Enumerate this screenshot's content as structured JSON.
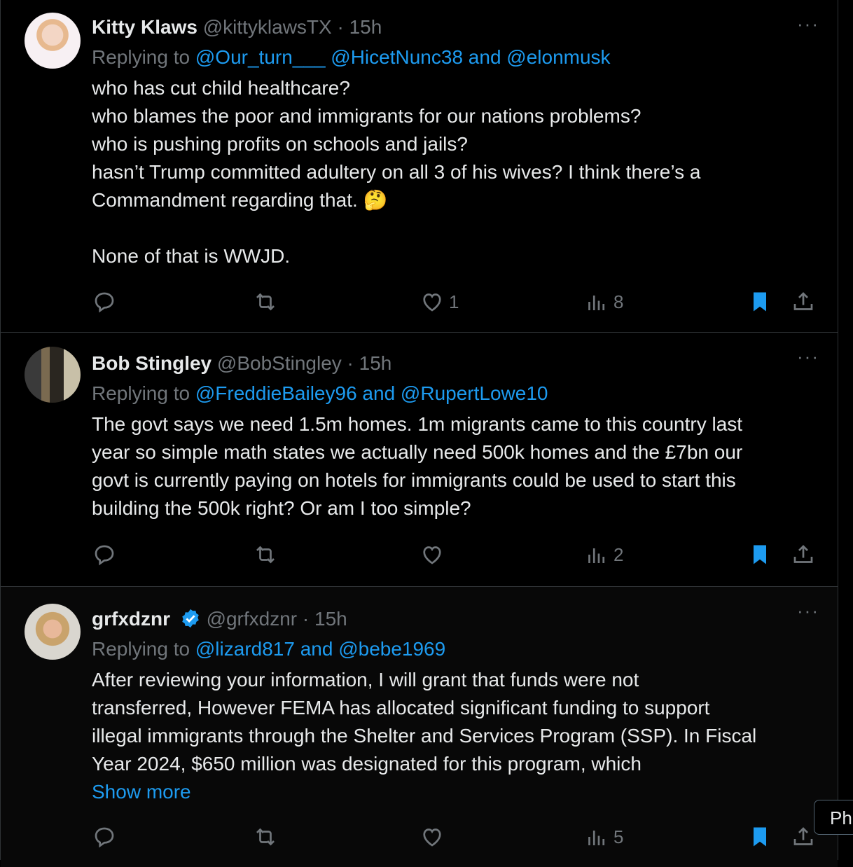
{
  "tweets": [
    {
      "name": "Kitty Klaws",
      "handle": "@kittyklawsTX",
      "time": "· 15h",
      "replying_prefix": "Replying to",
      "replying_to": "@Our_turn___ @HicetNunc38 and @elonmusk",
      "lines": [
        "who has cut child healthcare?",
        "who blames the poor and immigrants for our nations problems?",
        "who is pushing profits on schools and jails?",
        "hasn’t Trump committed adultery on all 3 of his wives? I think there’s a",
        "Commandment regarding that. 🤔",
        "",
        "None of that is WWJD."
      ],
      "likes": "1",
      "views": "8",
      "more": "···"
    },
    {
      "name": "Bob Stingley",
      "handle": "@BobStingley",
      "time": "· 15h",
      "replying_prefix": "Replying to",
      "replying_to": "@FreddieBailey96 and @RupertLowe10",
      "lines": [
        "The govt says we need 1.5m homes. 1m migrants came to this country last",
        "year so simple math states we actually need 500k homes and the £7bn our",
        "govt is currently paying on hotels for immigrants could be used to start this",
        "building the 500k right? Or am I too simple?"
      ],
      "likes": "",
      "views": "2",
      "more": "···"
    },
    {
      "name": "grfxdznr",
      "handle": "@grfxdznr",
      "time": "· 15h",
      "replying_prefix": "Replying to",
      "replying_to": "@lizard817 and @bebe1969",
      "lines": [
        "After reviewing your information, I will grant that funds were not",
        "transferred, However FEMA has allocated significant funding to support",
        "illegal immigrants through the Shelter and Services Program (SSP). In Fiscal",
        "Year 2024, $650 million was designated for this program, which"
      ],
      "show_more": "Show more",
      "likes": "",
      "views": "5",
      "more": "···"
    }
  ],
  "tooltip": "Ph",
  "colors": {
    "accent": "#1d9bf0",
    "muted": "#71767b",
    "text": "#e7e9ea",
    "border": "#2f3336"
  }
}
